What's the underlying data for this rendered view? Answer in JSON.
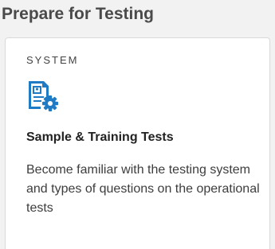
{
  "panel": {
    "title": "Prepare for Testing"
  },
  "card": {
    "category": "SYSTEM",
    "icon": "document-gear-icon",
    "heading": "Sample & Training Tests",
    "description": "Become familiar with the testing system and types of questions on the operational tests"
  },
  "colors": {
    "icon_blue": "#1f7bc4",
    "panel_background": "#f2f2f2",
    "card_border": "#d9d9d9"
  }
}
